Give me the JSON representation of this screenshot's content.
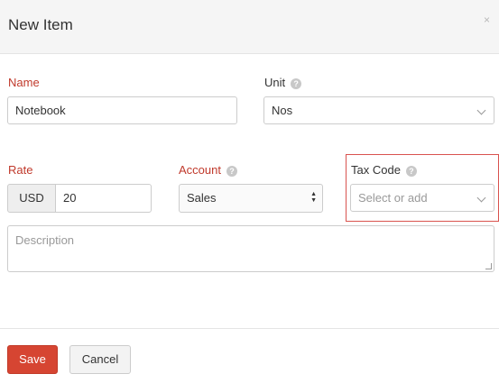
{
  "dialog": {
    "title": "New Item",
    "close_glyph": "×"
  },
  "fields": {
    "name": {
      "label": "Name",
      "value": "Notebook"
    },
    "unit": {
      "label": "Unit",
      "help": "?",
      "value": "Nos"
    },
    "rate": {
      "label": "Rate",
      "currency": "USD",
      "value": "20"
    },
    "account": {
      "label": "Account",
      "help": "?",
      "value": "Sales"
    },
    "tax_code": {
      "label": "Tax Code",
      "help": "?",
      "placeholder": "Select or add"
    },
    "description": {
      "placeholder": "Description"
    }
  },
  "actions": {
    "save_label": "Save",
    "cancel_label": "Cancel"
  },
  "colors": {
    "required_label": "#c0392b",
    "save_button": "#d64532",
    "highlight_border": "#d9534f"
  }
}
